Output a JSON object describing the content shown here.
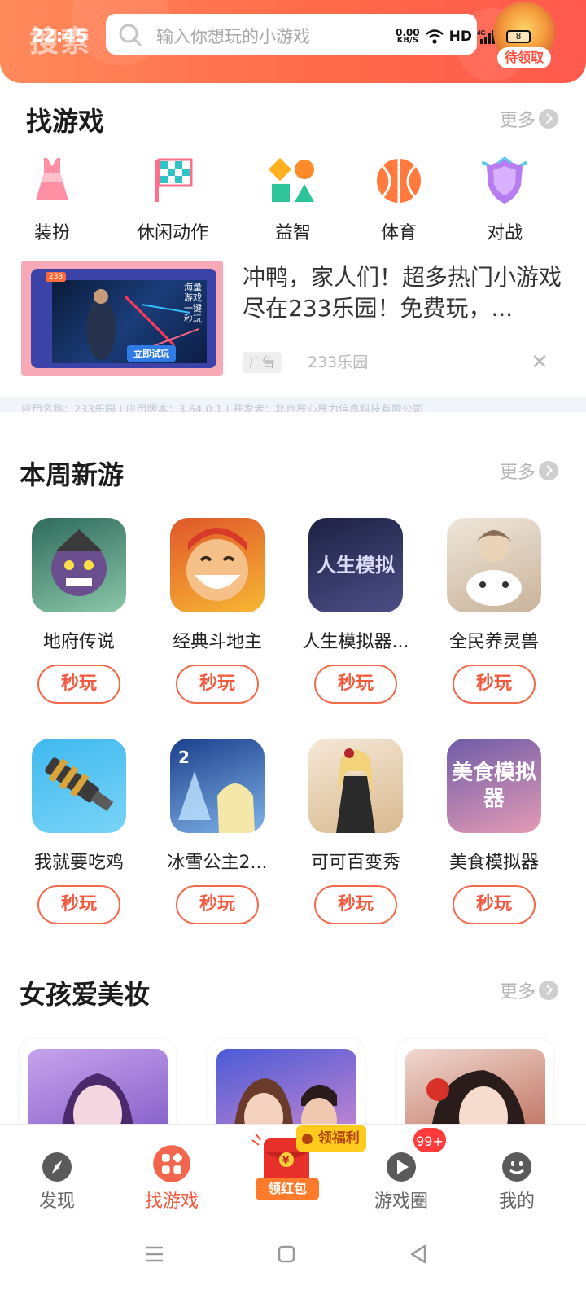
{
  "status_bar": {
    "time": "22:45",
    "net_speed_value": "0.00",
    "net_speed_unit": "KB/S",
    "hd": "HD",
    "battery": "8"
  },
  "header": {
    "logo_text": "搜索",
    "search_placeholder": "输入你想玩的小游戏",
    "gift_badge": "待领取"
  },
  "find_games": {
    "title": "找游戏",
    "more": "更多",
    "categories": [
      {
        "label": "装扮",
        "icon": "dress-icon"
      },
      {
        "label": "休闲动作",
        "icon": "checkered-flag-icon"
      },
      {
        "label": "益智",
        "icon": "shapes-icon"
      },
      {
        "label": "体育",
        "icon": "ball-icon"
      },
      {
        "label": "对战",
        "icon": "shield-icon"
      }
    ]
  },
  "ad": {
    "title": "冲鸭，家人们！超多热门小游戏尽在233乐园！免费玩，...",
    "badge": "广告",
    "source": "233乐园",
    "thumb_tag": "233",
    "thumb_side_text": "海量游戏一键秒玩",
    "thumb_button": "立即试玩",
    "app_info": "应用名称：233乐园 | 应用版本：3.64.0.1 | 开发者：北京展心展力信息科技有限公司"
  },
  "weekly_new": {
    "title": "本周新游",
    "more": "更多",
    "play_label": "秒玩",
    "games": [
      {
        "name": "地府传说",
        "colors": [
          "#2f6b5c",
          "#8bc7a9"
        ]
      },
      {
        "name": "经典斗地主",
        "colors": [
          "#e0572a",
          "#f7b733"
        ]
      },
      {
        "name": "人生模拟器...",
        "colors": [
          "#1e2143",
          "#4c4f86"
        ]
      },
      {
        "name": "全民养灵兽",
        "colors": [
          "#efe6da",
          "#c9b39a"
        ]
      },
      {
        "name": "我就要吃鸡",
        "colors": [
          "#3fb9ef",
          "#7ad4f7"
        ]
      },
      {
        "name": "冰雪公主2...",
        "colors": [
          "#1c3f8c",
          "#7fb3e8"
        ]
      },
      {
        "name": "可可百变秀",
        "colors": [
          "#f4e8d6",
          "#d9b98f"
        ]
      },
      {
        "name": "美食模拟器",
        "colors": [
          "#6f5ca8",
          "#e49bb5"
        ]
      }
    ],
    "icon_texts": {
      "life_sim": "人生模拟",
      "food": "美食模拟器"
    }
  },
  "girl_makeup": {
    "title": "女孩爱美妆",
    "more": "更多",
    "cards": [
      {
        "colors": [
          "#c6a3ec",
          "#7a55c4"
        ]
      },
      {
        "colors": [
          "#4b5bd6",
          "#d78bd0"
        ]
      },
      {
        "colors": [
          "#f0d8d0",
          "#b9634e"
        ]
      }
    ]
  },
  "bottom_nav": {
    "items": [
      {
        "label": "发现"
      },
      {
        "label": "找游戏"
      },
      {
        "label": "游戏圈"
      },
      {
        "label": "我的"
      }
    ],
    "redpack_label": "领红包",
    "welfare_label": "领福利",
    "notif_count": "99+"
  },
  "colors": {
    "accent": "#f25a3f",
    "header_start": "#ff8a5c",
    "header_end": "#ff5a4e"
  }
}
